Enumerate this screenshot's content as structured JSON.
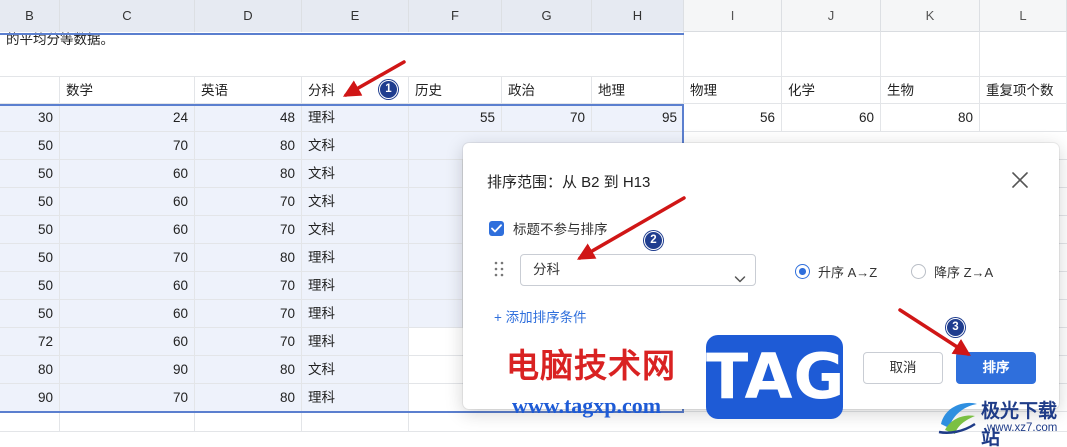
{
  "columns": [
    "B",
    "C",
    "D",
    "E",
    "F",
    "G",
    "H",
    "I",
    "J",
    "K",
    "L"
  ],
  "top_note": "的平均分等数据。",
  "header_row": [
    "",
    "数学",
    "英语",
    "分科",
    "历史",
    "政治",
    "地理",
    "物理",
    "化学",
    "生物",
    "重复项个数"
  ],
  "first_row": [
    "30",
    "24",
    "48",
    "理科",
    "55",
    "70",
    "95",
    "56",
    "60",
    "80",
    ""
  ],
  "rows": [
    [
      "50",
      "70",
      "80",
      "文科"
    ],
    [
      "50",
      "60",
      "80",
      "文科"
    ],
    [
      "50",
      "60",
      "70",
      "文科"
    ],
    [
      "50",
      "60",
      "70",
      "文科"
    ],
    [
      "50",
      "70",
      "80",
      "理科"
    ],
    [
      "50",
      "60",
      "70",
      "理科"
    ],
    [
      "50",
      "60",
      "70",
      "理科"
    ],
    [
      "72",
      "60",
      "70",
      "理科"
    ],
    [
      "80",
      "90",
      "80",
      "文科"
    ],
    [
      "90",
      "70",
      "80",
      "理科"
    ]
  ],
  "dialog": {
    "title": "排序范围：从 B2 到 H13",
    "checkbox_label": "标题不参与排序",
    "checkbox_checked": true,
    "sort_field": "分科",
    "asc_label": "升序 A→Z",
    "desc_label": "降序 Z→A",
    "selected_order": "asc",
    "add_condition": "+ 添加排序条件",
    "cancel_label": "取消",
    "sort_label": "排序"
  },
  "badges": [
    "1",
    "2",
    "3"
  ],
  "watermark": {
    "cn_text": "电脑技术网",
    "tag_text": "TAG",
    "url_text": "www.tagxp.com",
    "logo_title": "极光下载站",
    "logo_url": "www.xz7.com"
  },
  "colors": {
    "accent": "#2f6fdc",
    "selection_border": "#5b7fcf",
    "selection_fill": "#eef2fb",
    "annotation_arrow": "#d01616",
    "badge": "#1f3d8f"
  }
}
